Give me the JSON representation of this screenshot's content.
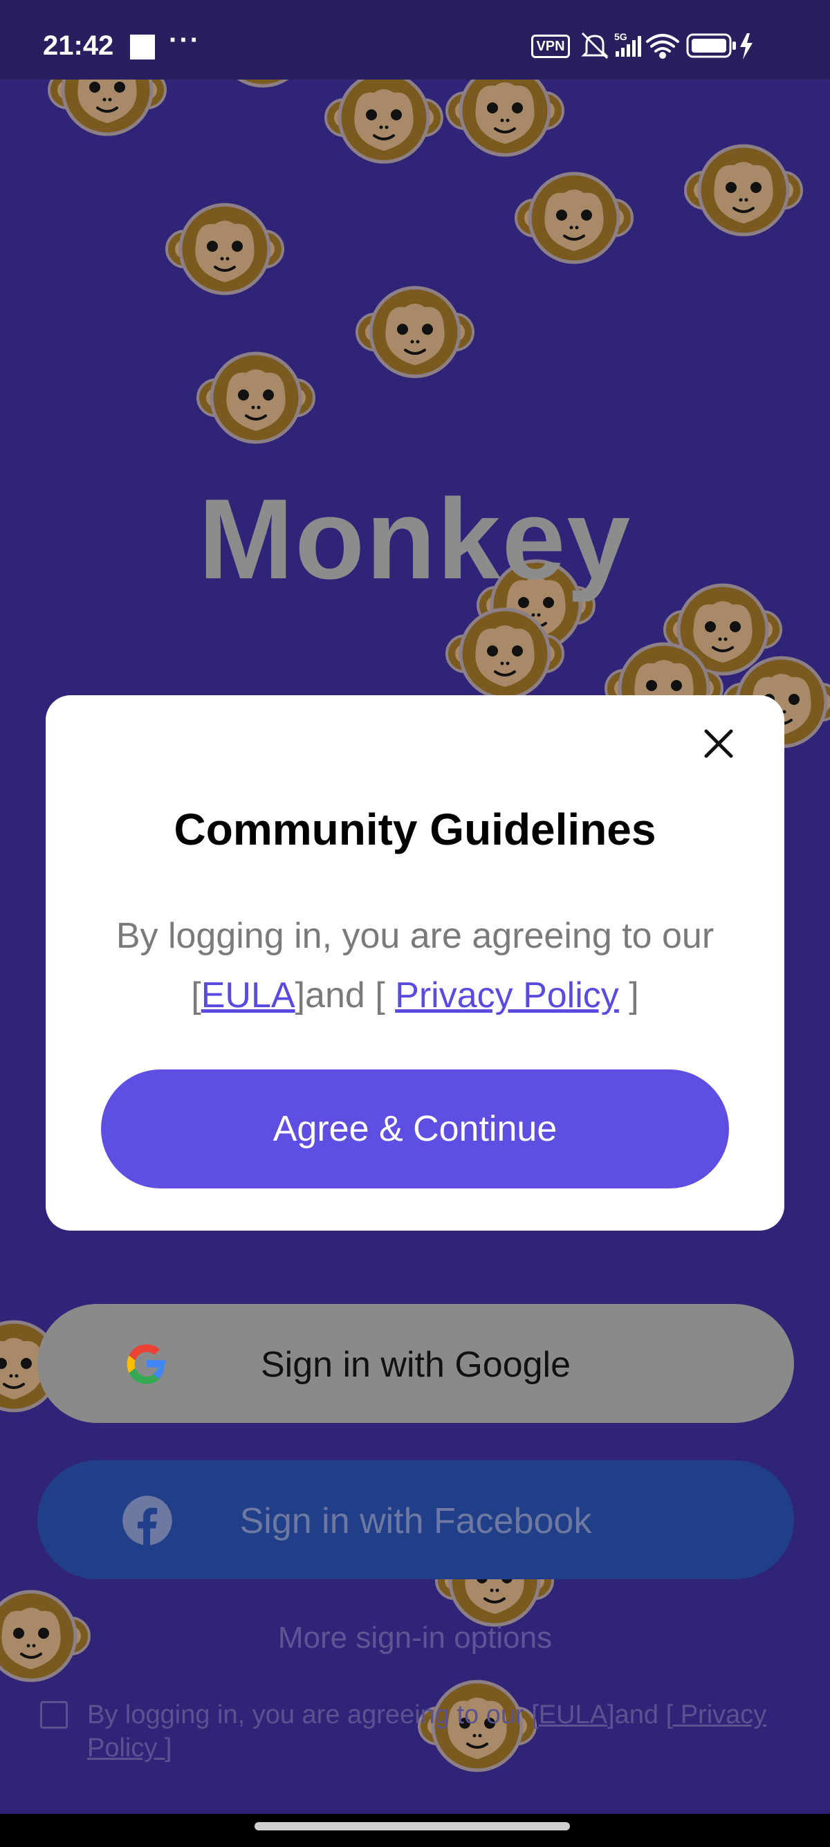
{
  "status_bar": {
    "time": "21:42",
    "more": "···",
    "vpn": "VPN",
    "icons": [
      "square-notification-icon",
      "vpn-icon",
      "bell-muted-icon",
      "signal-5g-icon",
      "wifi-icon",
      "battery-icon",
      "charging-icon"
    ]
  },
  "app": {
    "title": "Monkey"
  },
  "modal": {
    "title": "Community Guidelines",
    "body_prefix": "By logging in, you are agreeing to our",
    "bracket_open_1": "[",
    "eula_link": "EULA",
    "and_text": "]and [ ",
    "privacy_link": "Privacy Policy",
    "bracket_close_2": " ]",
    "agree_button": "Agree & Continue"
  },
  "sign_in": {
    "google_label": "Sign in with Google",
    "facebook_label": "Sign in with Facebook",
    "more_options": "More sign-in options"
  },
  "consent": {
    "prefix": "By logging in, you are agreeing to our ",
    "eula_open": "[",
    "eula_link": "EULA",
    "middle": "]and ",
    "privacy_link": "[ Privacy Policy ]"
  },
  "colors": {
    "background": "#2f2478",
    "accent": "#5e4ee2",
    "link": "#5a4be0",
    "facebook": "#213f88"
  }
}
